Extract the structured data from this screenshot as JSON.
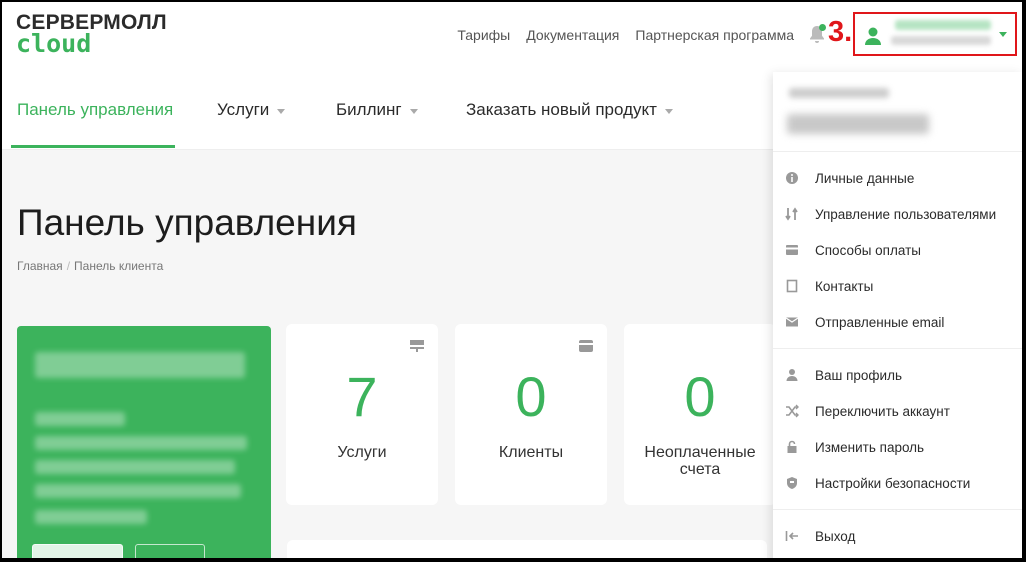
{
  "brand": {
    "line1": "СЕРВЕРМОЛЛ",
    "line2": "cloud"
  },
  "top_links": [
    "Тарифы",
    "Документация",
    "Партнерская программа"
  ],
  "annotation": "3.",
  "nav": {
    "items": [
      {
        "label": "Панель управления",
        "active": true
      },
      {
        "label": "Услуги",
        "has_menu": true
      },
      {
        "label": "Биллинг",
        "has_menu": true
      },
      {
        "label": "Заказать новый продукт",
        "has_menu": true
      }
    ]
  },
  "page": {
    "title": "Панель управления",
    "breadcrumb": [
      "Главная",
      "Панель клиента"
    ]
  },
  "stats": [
    {
      "value": "7",
      "label": "Услуги",
      "icon": "server-icon"
    },
    {
      "value": "0",
      "label": "Клиенты",
      "icon": "card-icon"
    },
    {
      "value": "0",
      "label": "Неоплаченные счета",
      "icon": ""
    }
  ],
  "dropdown": {
    "section1": [
      {
        "label": "Личные данные",
        "icon": "info-icon"
      },
      {
        "label": "Управление пользователями",
        "icon": "sort-icon"
      },
      {
        "label": "Способы оплаты",
        "icon": "card-icon"
      },
      {
        "label": "Контакты",
        "icon": "contact-icon"
      },
      {
        "label": "Отправленные email",
        "icon": "mail-icon"
      }
    ],
    "section2": [
      {
        "label": "Ваш профиль",
        "icon": "user-icon"
      },
      {
        "label": "Переключить аккаунт",
        "icon": "shuffle-icon"
      },
      {
        "label": "Изменить пароль",
        "icon": "lock-icon"
      },
      {
        "label": "Настройки безопасности",
        "icon": "shield-icon"
      }
    ],
    "section3": [
      {
        "label": "Выход",
        "icon": "logout-icon"
      }
    ]
  },
  "colors": {
    "accent": "#3cb35c",
    "highlight": "#e0161a"
  }
}
